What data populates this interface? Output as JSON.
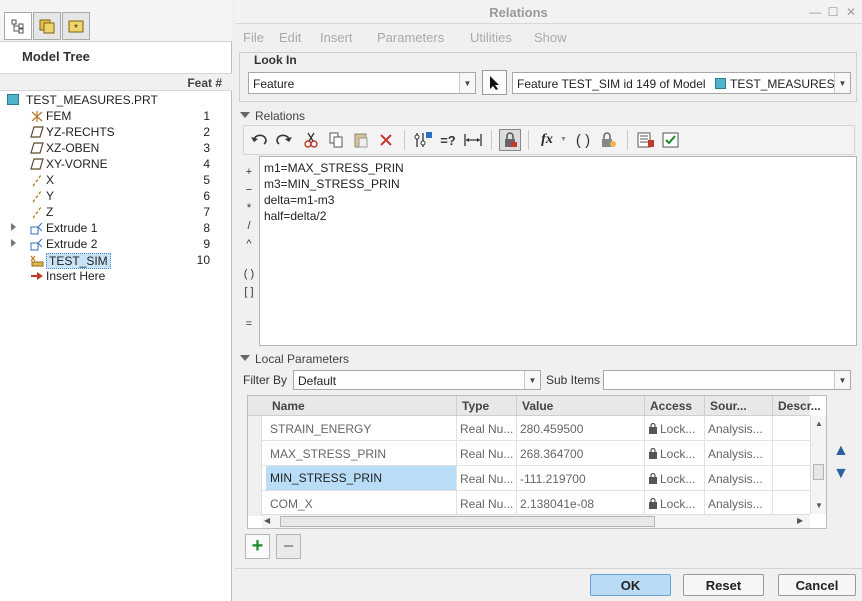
{
  "left": {
    "model_tree_title": "Model Tree",
    "feat_header": "Feat #",
    "root": "TEST_MEASURES.PRT",
    "items": [
      {
        "label": "FEM",
        "num": "1",
        "icon": "coord-sys-icon"
      },
      {
        "label": "YZ-RECHTS",
        "num": "2",
        "icon": "datum-plane-icon"
      },
      {
        "label": "XZ-OBEN",
        "num": "3",
        "icon": "datum-plane-icon"
      },
      {
        "label": "XY-VORNE",
        "num": "4",
        "icon": "datum-plane-icon"
      },
      {
        "label": "X",
        "num": "5",
        "icon": "datum-axis-icon"
      },
      {
        "label": "Y",
        "num": "6",
        "icon": "datum-axis-icon"
      },
      {
        "label": "Z",
        "num": "7",
        "icon": "datum-axis-icon"
      },
      {
        "label": "Extrude 1",
        "num": "8",
        "icon": "extrude-icon"
      },
      {
        "label": "Extrude 2",
        "num": "9",
        "icon": "extrude-icon"
      },
      {
        "label": "TEST_SIM",
        "num": "10",
        "icon": "analysis-icon"
      },
      {
        "label": "Insert Here",
        "num": "",
        "icon": "insert-arrow-icon"
      }
    ]
  },
  "dialog": {
    "title": "Relations",
    "menu": [
      "File",
      "Edit",
      "Insert",
      "Parameters",
      "Utilities",
      "Show"
    ],
    "look_in_label": "Look In",
    "look_in_value": "Feature",
    "feature_prefix": "Feature TEST_SIM id 149 of Model",
    "feature_model": "TEST_MEASURES",
    "relations_label": "Relations",
    "relations_lines": [
      "m1=MAX_STRESS_PRIN",
      "m3=MIN_STRESS_PRIN",
      "delta=m1-m3",
      "half=delta/2"
    ],
    "operators": [
      "+",
      "−",
      "*",
      "/",
      "^",
      "( )",
      "[ ]",
      "="
    ],
    "local_params_label": "Local Parameters",
    "filter_by_label": "Filter By",
    "filter_by_value": "Default",
    "sub_items_label": "Sub Items",
    "sub_items_value": "",
    "columns": [
      "Name",
      "Type",
      "Value",
      "Access",
      "Sour...",
      "Descr..."
    ],
    "rows": [
      {
        "name": "STRAIN_ENERGY",
        "type": "Real Nu...",
        "value": "280.459500",
        "access": "Lock...",
        "source": "Analysis..."
      },
      {
        "name": "MAX_STRESS_PRIN",
        "type": "Real Nu...",
        "value": "268.364700",
        "access": "Lock...",
        "source": "Analysis..."
      },
      {
        "name": "MIN_STRESS_PRIN",
        "type": "Real Nu...",
        "value": "-111.219700",
        "access": "Lock...",
        "source": "Analysis..."
      },
      {
        "name": "COM_X",
        "type": "Real Nu...",
        "value": "2.138041e-08",
        "access": "Lock...",
        "source": "Analysis..."
      }
    ],
    "selected_row": 2,
    "ok_label": "OK",
    "reset_label": "Reset",
    "cancel_label": "Cancel"
  }
}
